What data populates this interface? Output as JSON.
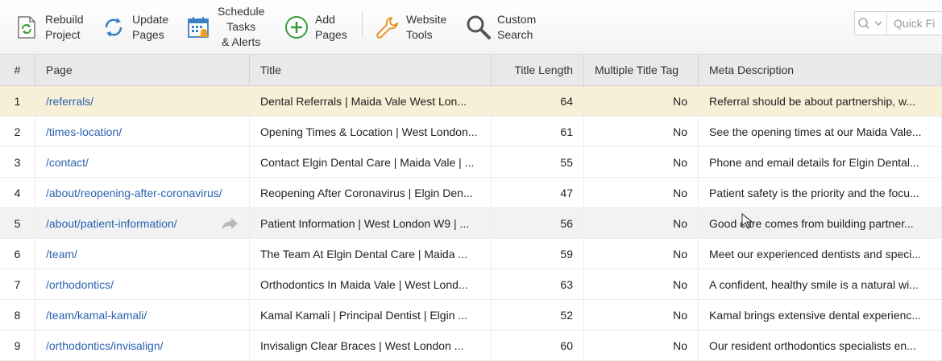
{
  "toolbar": {
    "rebuild": "Rebuild\nProject",
    "update": "Update\nPages",
    "schedule": "Schedule\nTasks\n& Alerts",
    "add": "Add\nPages",
    "website_tools": "Website\nTools",
    "custom_search": "Custom\nSearch",
    "quick_filter_placeholder": "Quick Fi"
  },
  "columns": [
    "#",
    "Page",
    "Title",
    "Title Length",
    "Multiple Title Tag",
    "Meta Description"
  ],
  "rows": [
    {
      "num": "1",
      "page": "/referrals/",
      "title": "Dental Referrals | Maida Vale West Lon...",
      "len": "64",
      "multi": "No",
      "meta": "Referral should be about partnership, w..."
    },
    {
      "num": "2",
      "page": "/times-location/",
      "title": "Opening Times & Location | West London...",
      "len": "61",
      "multi": "No",
      "meta": "See the opening times at our Maida Vale..."
    },
    {
      "num": "3",
      "page": "/contact/",
      "title": "Contact Elgin Dental Care | Maida Vale | ...",
      "len": "55",
      "multi": "No",
      "meta": "Phone and email details for Elgin Dental..."
    },
    {
      "num": "4",
      "page": "/about/reopening-after-coronavirus/",
      "title": "Reopening After Coronavirus | Elgin Den...",
      "len": "47",
      "multi": "No",
      "meta": "Patient safety is the priority and the focu..."
    },
    {
      "num": "5",
      "page": "/about/patient-information/",
      "title": "Patient Information | West London W9 | ...",
      "len": "56",
      "multi": "No",
      "meta": "Good care comes from building partner..."
    },
    {
      "num": "6",
      "page": "/team/",
      "title": "The Team At Elgin Dental Care | Maida ...",
      "len": "59",
      "multi": "No",
      "meta": "Meet our experienced dentists and speci..."
    },
    {
      "num": "7",
      "page": "/orthodontics/",
      "title": "Orthodontics In Maida Vale | West Lond...",
      "len": "63",
      "multi": "No",
      "meta": "A confident, healthy smile is a natural wi..."
    },
    {
      "num": "8",
      "page": "/team/kamal-kamali/",
      "title": "Kamal Kamali | Principal Dentist | Elgin ...",
      "len": "52",
      "multi": "No",
      "meta": "Kamal brings extensive dental experienc..."
    },
    {
      "num": "9",
      "page": "/orthodontics/invisalign/",
      "title": "Invisalign Clear Braces | West London ...",
      "len": "60",
      "multi": "No",
      "meta": "Our resident orthodontics specialists en..."
    }
  ]
}
